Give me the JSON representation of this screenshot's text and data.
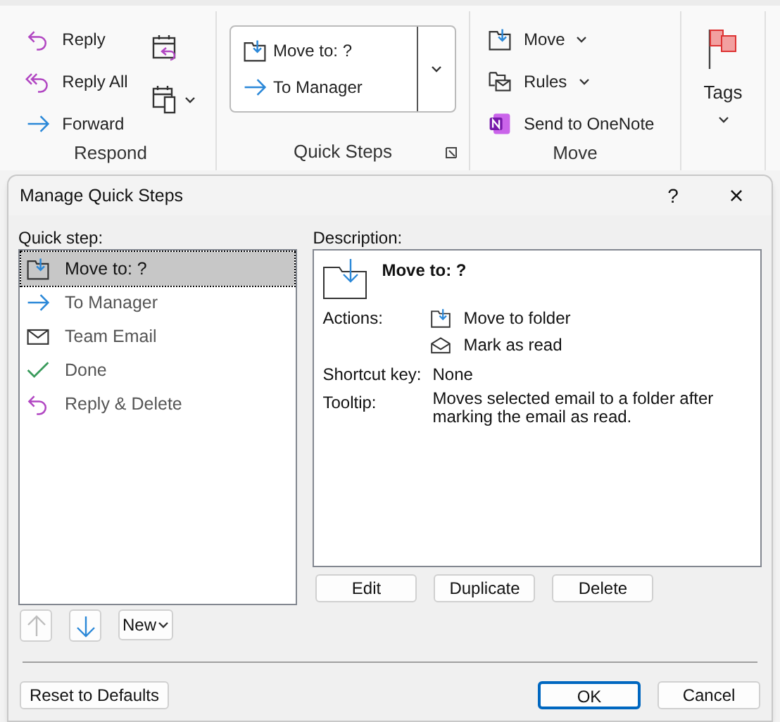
{
  "ribbon": {
    "groups": [
      {
        "kind": "respond",
        "label": "Respond",
        "items": [
          {
            "kind": "reply",
            "label": "Reply"
          },
          {
            "kind": "reply-all",
            "label": "Reply All"
          },
          {
            "kind": "forward",
            "label": "Forward"
          }
        ]
      },
      {
        "kind": "quicksteps",
        "label": "Quick Steps",
        "items": [
          {
            "kind": "move",
            "label": "Move to: ?"
          },
          {
            "kind": "forward",
            "label": "To Manager"
          }
        ]
      },
      {
        "kind": "move",
        "label": "Move",
        "items": [
          {
            "kind": "move",
            "label": "Move",
            "dropdown": true
          },
          {
            "kind": "rules",
            "label": "Rules",
            "dropdown": true
          },
          {
            "kind": "onenote",
            "label": "Send to OneNote",
            "dropdown": false
          }
        ]
      },
      {
        "kind": "tags",
        "label": "Tags"
      }
    ]
  },
  "dialog": {
    "title": "Manage Quick Steps",
    "help": "?",
    "close": "×",
    "list_label": "Quick step:",
    "steps": [
      {
        "kind": "move",
        "label": "Move to: ?",
        "selected": true
      },
      {
        "kind": "forward",
        "label": "To Manager",
        "selected": false
      },
      {
        "kind": "mail",
        "label": "Team Email",
        "selected": false
      },
      {
        "kind": "check",
        "label": "Done",
        "selected": false
      },
      {
        "kind": "reply",
        "label": "Reply & Delete",
        "selected": false
      }
    ],
    "description_label": "Description:",
    "description": {
      "title": "Move to: ?",
      "actions_label": "Actions:",
      "actions": [
        {
          "kind": "move",
          "label": "Move to folder"
        },
        {
          "kind": "read",
          "label": "Mark as read"
        }
      ],
      "shortcut_label": "Shortcut key:",
      "shortcut": "None",
      "tooltip_label": "Tooltip:",
      "tooltip": "Moves selected email to a folder after marking the email as read."
    },
    "edit_buttons": [
      {
        "label": "Edit"
      },
      {
        "label": "Duplicate"
      },
      {
        "label": "Delete"
      }
    ],
    "move_up": {
      "disabled": true
    },
    "move_down": {
      "disabled": false
    },
    "new_button": {
      "label": "New"
    },
    "reset_button": {
      "label": "Reset to Defaults"
    },
    "ok_button": {
      "label": "OK",
      "default": true
    },
    "cancel_button": {
      "label": "Cancel",
      "default": false
    }
  }
}
